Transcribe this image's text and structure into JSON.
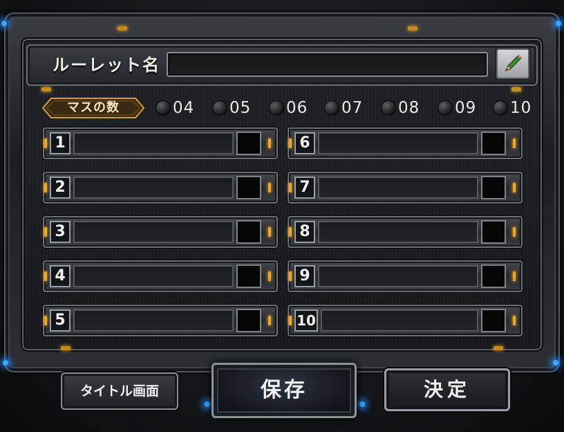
{
  "header": {
    "roulette_name_label": "ルーレット名",
    "roulette_name_value": "",
    "edit_icon": "pencil-icon"
  },
  "count": {
    "label": "マスの数",
    "options": [
      "04",
      "05",
      "06",
      "07",
      "08",
      "09",
      "10"
    ]
  },
  "slots": [
    {
      "number": "1",
      "value": ""
    },
    {
      "number": "2",
      "value": ""
    },
    {
      "number": "3",
      "value": ""
    },
    {
      "number": "4",
      "value": ""
    },
    {
      "number": "5",
      "value": ""
    },
    {
      "number": "6",
      "value": ""
    },
    {
      "number": "7",
      "value": ""
    },
    {
      "number": "8",
      "value": ""
    },
    {
      "number": "9",
      "value": ""
    },
    {
      "number": "10",
      "value": ""
    }
  ],
  "buttons": {
    "title_screen": "タイトル画面",
    "save": "保存",
    "confirm": "決定"
  },
  "colors": {
    "accent_amber": "#f0a52a",
    "accent_blue": "#3aa6ff",
    "panel_dark": "#17191c"
  }
}
